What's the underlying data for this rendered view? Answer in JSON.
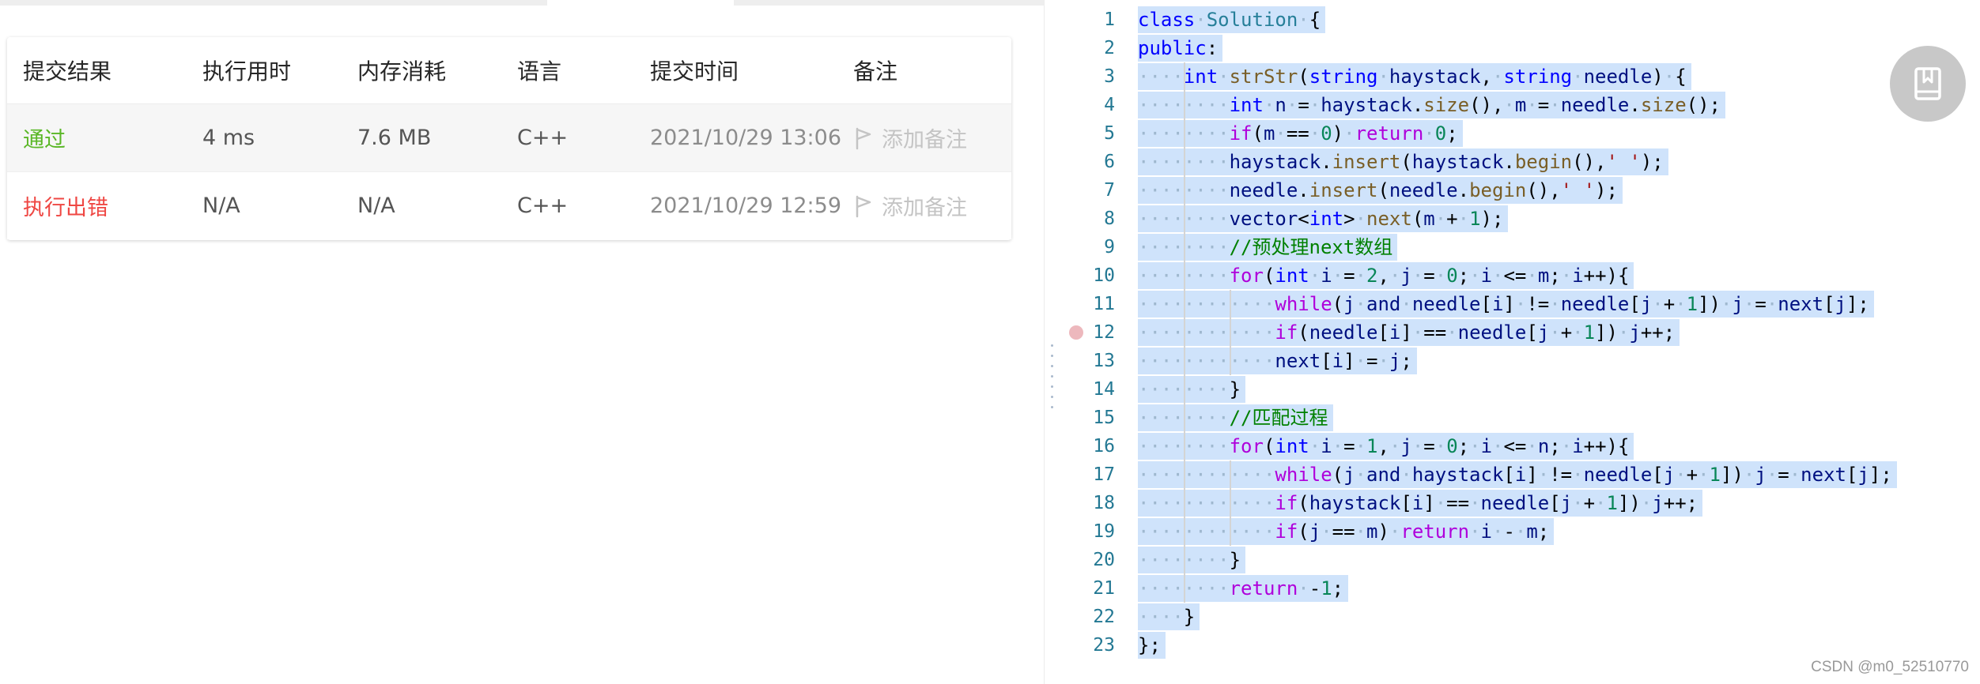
{
  "submissions": {
    "columns": [
      "提交结果",
      "执行用时",
      "内存消耗",
      "语言",
      "提交时间",
      "备注"
    ],
    "rows": [
      {
        "status": "通过",
        "status_color": "#5ab726",
        "runtime": "4 ms",
        "memory": "7.6 MB",
        "language": "C++",
        "submitted_at": "2021/10/29 13:06",
        "note": "添加备注"
      },
      {
        "status": "执行出错",
        "status_color": "#ef4743",
        "runtime": "N/A",
        "memory": "N/A",
        "language": "C++",
        "submitted_at": "2021/10/29 12:59",
        "note": "添加备注"
      }
    ]
  },
  "editor": {
    "selection_color": "#cfe3fb",
    "line_number_color": "#237893",
    "breakpoint_line": 12,
    "lines": [
      "class Solution {",
      "public:",
      "    int strStr(string haystack, string needle) {",
      "        int n = haystack.size(), m = needle.size();",
      "        if(m == 0) return 0;",
      "        haystack.insert(haystack.begin(),' ');",
      "        needle.insert(needle.begin(),' ');",
      "        vector<int> next(m + 1);",
      "        //预处理next数组",
      "        for(int i = 2, j = 0; i <= m; i++){",
      "            while(j and needle[i] != needle[j + 1]) j = next[j];",
      "            if(needle[i] == needle[j + 1]) j++;",
      "            next[i] = j;",
      "        }",
      "        //匹配过程",
      "        for(int i = 1, j = 0; i <= n; i++){",
      "            while(j and haystack[i] != needle[j + 1]) j = next[j];",
      "            if(haystack[i] == needle[j + 1]) j++;",
      "            if(j == m) return i - m;",
      "        }",
      "        return -1;",
      "    }",
      "};"
    ]
  },
  "floating_button": {
    "icon": "book-icon"
  },
  "watermark": "CSDN @m0_52510770"
}
